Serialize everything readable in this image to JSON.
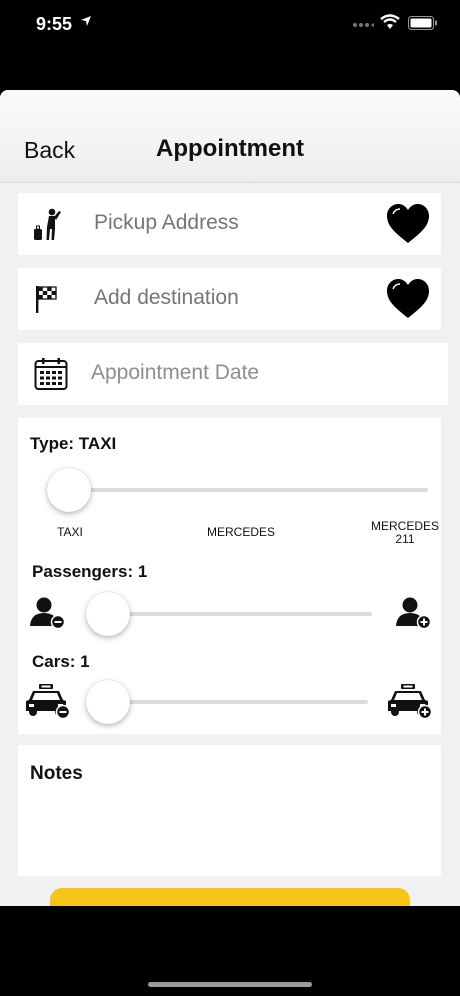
{
  "status": {
    "time": "9:55"
  },
  "nav": {
    "back": "Back",
    "title": "Appointment"
  },
  "pickup": {
    "placeholder": "Pickup Address"
  },
  "destination": {
    "placeholder": "Add destination"
  },
  "date": {
    "placeholder": "Appointment Date"
  },
  "type": {
    "label": "Type: TAXI",
    "options": [
      "TAXI",
      "MERCEDES",
      "MERCEDES\n211"
    ],
    "value": 0
  },
  "passengers": {
    "label": "Passengers: 1",
    "value": 1
  },
  "cars": {
    "label": "Cars: 1",
    "value": 1
  },
  "notes": {
    "label": "Notes"
  },
  "colors": {
    "accent": "#f5c518"
  }
}
